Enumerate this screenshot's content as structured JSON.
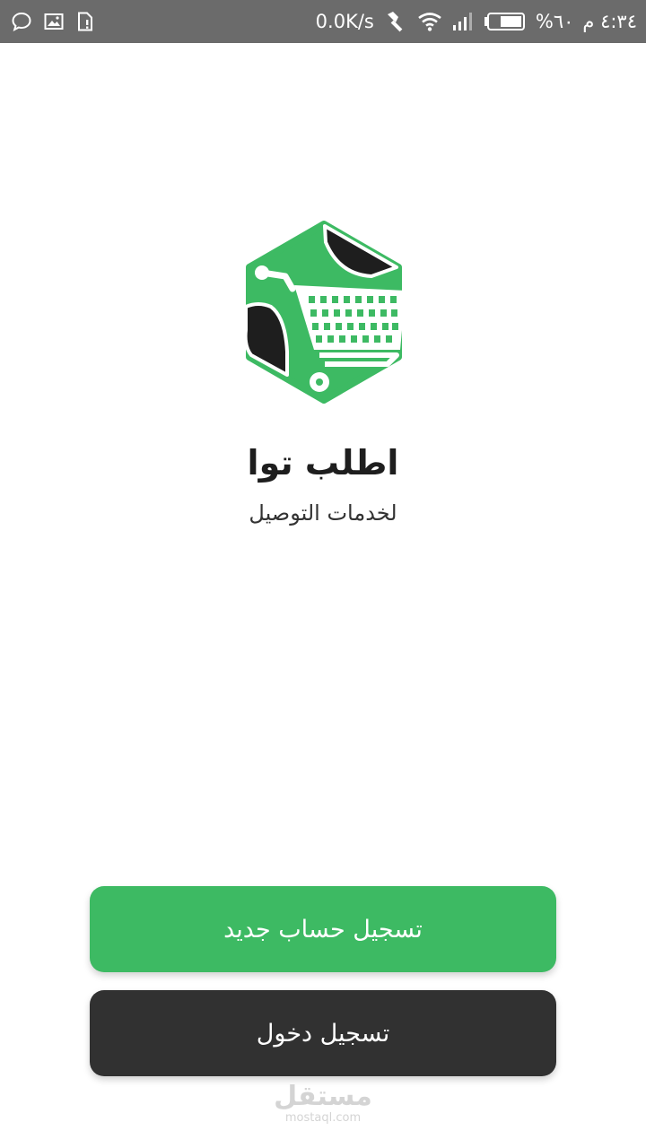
{
  "status_bar": {
    "time": "٤:٣٤ م",
    "battery": "%٦٠",
    "network_speed": "0.0K/s",
    "left_icons": [
      "chat-bubble-icon",
      "image-icon",
      "file-icon"
    ],
    "right_icons": [
      "key-icon",
      "wifi-icon",
      "signal-icon",
      "battery-icon"
    ],
    "bar_color": "#6b6b6b"
  },
  "app": {
    "title": "اطلب توا",
    "subtitle": "لخدمات التوصيل",
    "logo_icon": "shopping-cart-hexagon-logo",
    "brand_color": "#3dba63",
    "dark_color": "#313131"
  },
  "buttons": {
    "register_label": "تسجيل حساب جديد",
    "login_label": "تسجيل دخول"
  },
  "watermark": {
    "logo_text": "مستقل",
    "url": "mostaql.com"
  }
}
